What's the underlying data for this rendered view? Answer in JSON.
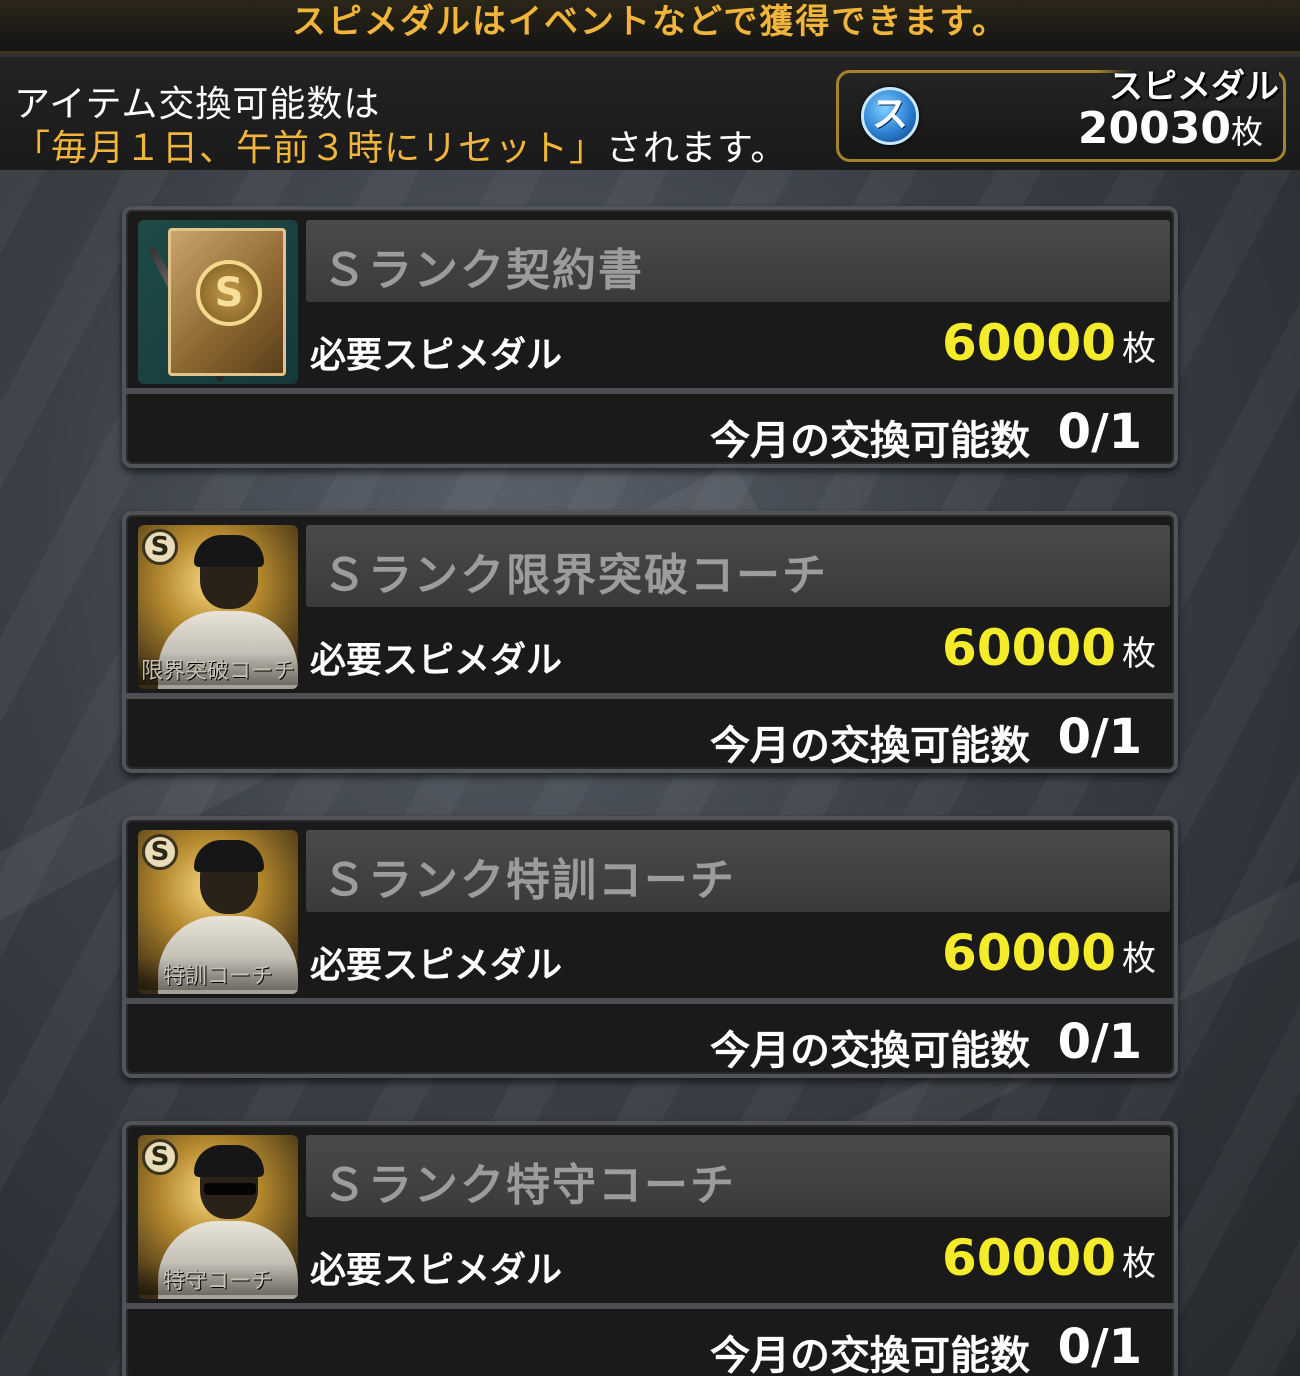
{
  "banner": {
    "text": "スピメダルはイベントなどで獲得できます。"
  },
  "info": {
    "line1": "アイテム交換可能数は",
    "line2_highlight": "「毎月１日、午前３時にリセット」",
    "line2_rest": "されます。"
  },
  "medal": {
    "title": "スピメダル",
    "icon_glyph": "ス",
    "count": "20030",
    "unit": "枚"
  },
  "items": [
    {
      "title": "Ｓランク契約書",
      "thumb_type": "contract",
      "thumb_label": "",
      "required_label": "必要スピメダル",
      "required_value": "60000",
      "required_unit": "枚",
      "limit_label": "今月の交換可能数",
      "limit_value": "0/1"
    },
    {
      "title": "Ｓランク限界突破コーチ",
      "thumb_type": "coach",
      "thumb_label": "限界突破コーチ",
      "badge": "S",
      "required_label": "必要スピメダル",
      "required_value": "60000",
      "required_unit": "枚",
      "limit_label": "今月の交換可能数",
      "limit_value": "0/1"
    },
    {
      "title": "Ｓランク特訓コーチ",
      "thumb_type": "coach",
      "thumb_label": "特訓コーチ",
      "badge": "S",
      "required_label": "必要スピメダル",
      "required_value": "60000",
      "required_unit": "枚",
      "limit_label": "今月の交換可能数",
      "limit_value": "0/1"
    },
    {
      "title": "Ｓランク特守コーチ",
      "thumb_type": "coach",
      "thumb_label": "特守コーチ",
      "badge": "S",
      "required_label": "必要スピメダル",
      "required_value": "60000",
      "required_unit": "枚",
      "limit_label": "今月の交換可能数",
      "limit_value": "0/1"
    }
  ],
  "colors": {
    "accent_gold": "#f0b53a",
    "price_yellow": "#f4ec2a",
    "medal_blue": "#2c7fd0"
  },
  "icons": {
    "medal": "spi-medal-icon",
    "contract": "contract-book-icon",
    "coach": "coach-portrait-icon"
  }
}
